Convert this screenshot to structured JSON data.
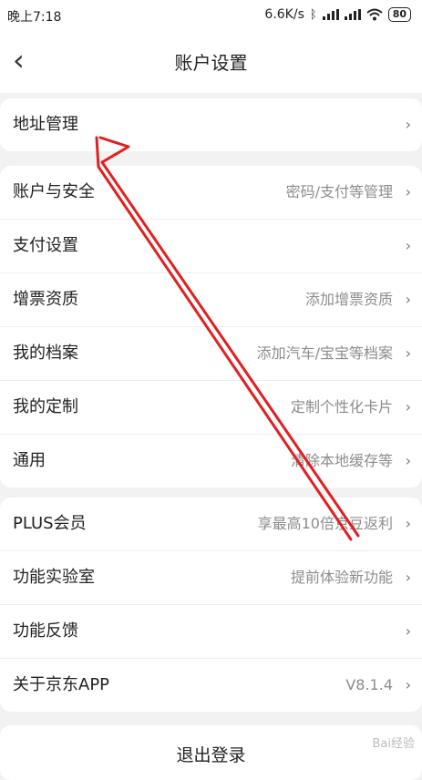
{
  "status_bar": {
    "time": "晚上7:18",
    "speed": "6.6K/s",
    "battery": "80"
  },
  "header": {
    "title": "账户设置"
  },
  "groups": [
    {
      "rows": [
        {
          "label": "地址管理",
          "value": ""
        }
      ]
    },
    {
      "rows": [
        {
          "label": "账户与安全",
          "value": "密码/支付等管理"
        },
        {
          "label": "支付设置",
          "value": ""
        },
        {
          "label": "增票资质",
          "value": "添加增票资质"
        },
        {
          "label": "我的档案",
          "value": "添加汽车/宝宝等档案"
        },
        {
          "label": "我的定制",
          "value": "定制个性化卡片"
        },
        {
          "label": "通用",
          "value": "清除本地缓存等"
        }
      ]
    },
    {
      "rows": [
        {
          "label": "PLUS会员",
          "value": "享最高10倍京豆返利"
        },
        {
          "label": "功能实验室",
          "value": "提前体验新功能"
        },
        {
          "label": "功能反馈",
          "value": ""
        },
        {
          "label": "关于京东APP",
          "value": "V8.1.4"
        }
      ]
    }
  ],
  "logout": {
    "label": "退出登录"
  },
  "watermark": "Bai经验",
  "colors": {
    "annotation_arrow": "#e02020",
    "background": "#f2f2f2"
  }
}
